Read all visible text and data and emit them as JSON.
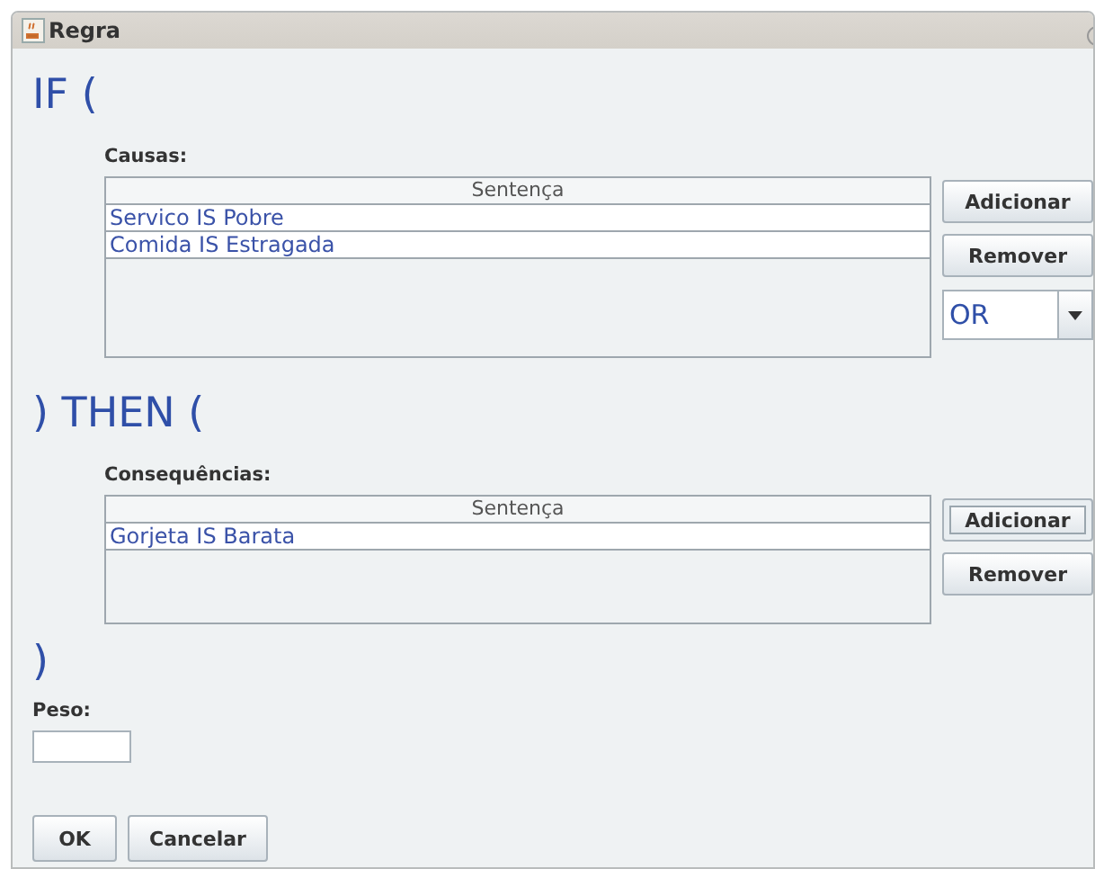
{
  "window": {
    "title": "Regra"
  },
  "sections": [
    {
      "heading": "IF (",
      "label": "Causas:",
      "table": {
        "columns": [
          "Sentença"
        ],
        "rows": [
          "Servico IS Pobre",
          "Comida IS Estragada"
        ]
      },
      "buttons": [
        {
          "label": "Adicionar",
          "focused": false
        },
        {
          "label": "Remover",
          "focused": false
        }
      ],
      "operator": {
        "value": "OR"
      }
    },
    {
      "heading": ") THEN (",
      "label": "Consequências:",
      "table": {
        "columns": [
          "Sentença"
        ],
        "rows": [
          "Gorjeta IS Barata"
        ]
      },
      "buttons": [
        {
          "label": "Adicionar",
          "focused": true
        },
        {
          "label": "Remover",
          "focused": false
        }
      ]
    }
  ],
  "closing": ")",
  "weight": {
    "label": "Peso:"
  },
  "actions": [
    "OK",
    "Cancelar"
  ]
}
